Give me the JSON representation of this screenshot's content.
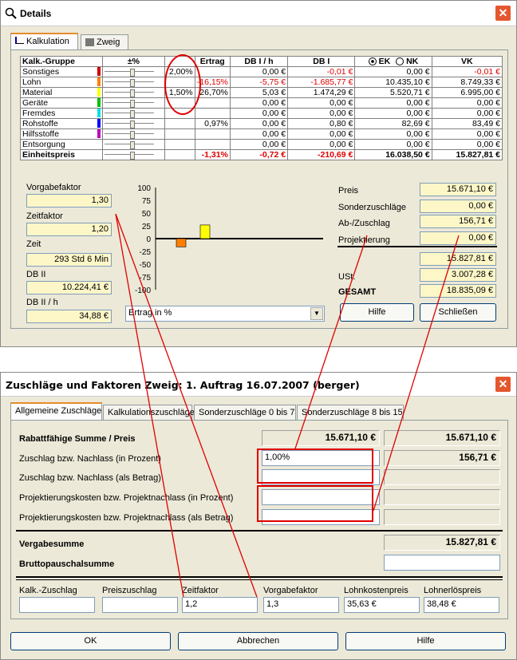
{
  "details": {
    "title": "Details",
    "close": "✕",
    "tabs": [
      "Kalkulation",
      "Zweig"
    ],
    "table": {
      "headers": [
        "Kalk.-Gruppe",
        "±%",
        "Ertrag",
        "DB I / h",
        "DB I",
        "EK",
        "NK",
        "VK"
      ],
      "rows": [
        {
          "name": "Sonstiges",
          "color": "#d00000",
          "pct": "2,00%",
          "ertrag": "",
          "dbih": "0,00 €",
          "dbi": "-0,01 €",
          "ek": "0,00 €",
          "vk": "-0,01 €",
          "red": {
            "dbi": true,
            "vk": true
          }
        },
        {
          "name": "Lohn",
          "color": "#ff7f00",
          "pct": "",
          "ertrag": "-16,15%",
          "dbih": "-5,75 €",
          "dbi": "-1.685,77 €",
          "ek": "10.435,10 €",
          "vk": "8.749,33 €",
          "red": {
            "ertrag": true,
            "dbih": true,
            "dbi": true
          }
        },
        {
          "name": "Material",
          "color": "#ffff00",
          "pct": "1,50%",
          "ertrag": "26,70%",
          "dbih": "5,03 €",
          "dbi": "1.474,29 €",
          "ek": "5.520,71 €",
          "vk": "6.995,00 €",
          "red": {}
        },
        {
          "name": "Geräte",
          "color": "#00c000",
          "pct": "",
          "ertrag": "",
          "dbih": "0,00 €",
          "dbi": "0,00 €",
          "ek": "0,00 €",
          "vk": "0,00 €",
          "red": {}
        },
        {
          "name": "Fremdes",
          "color": "#00e0e0",
          "pct": "",
          "ertrag": "",
          "dbih": "0,00 €",
          "dbi": "0,00 €",
          "ek": "0,00 €",
          "vk": "0,00 €",
          "red": {}
        },
        {
          "name": "Rohstoffe",
          "color": "#0000ff",
          "pct": "",
          "ertrag": "0,97%",
          "dbih": "0,00 €",
          "dbi": "0,80 €",
          "ek": "82,69 €",
          "vk": "83,49 €",
          "red": {}
        },
        {
          "name": "Hilfsstoffe",
          "color": "#c000c0",
          "pct": "",
          "ertrag": "",
          "dbih": "0,00 €",
          "dbi": "0,00 €",
          "ek": "0,00 €",
          "vk": "0,00 €",
          "red": {}
        },
        {
          "name": "Entsorgung",
          "color": "#ffffff",
          "pct": "",
          "ertrag": "",
          "dbih": "0,00 €",
          "dbi": "0,00 €",
          "ek": "0,00 €",
          "vk": "0,00 €",
          "red": {}
        },
        {
          "name": "Einheitspreis",
          "color": "#ffffff",
          "pct": "",
          "ertrag": "-1,31%",
          "dbih": "-0,72 €",
          "dbi": "-210,69 €",
          "ek": "16.038,50 €",
          "vk": "15.827,81 €",
          "red": {
            "ertrag": true,
            "dbih": true,
            "dbi": true
          },
          "bold": true
        }
      ]
    },
    "left": {
      "vorgabefaktor_label": "Vorgabefaktor",
      "vorgabefaktor": "1,30",
      "zeitfaktor_label": "Zeitfaktor",
      "zeitfaktor": "1,20",
      "zeit_label": "Zeit",
      "zeit": "293 Std 6 Min",
      "db2_label": "DB II",
      "db2": "10.224,41 €",
      "db2h_label": "DB II / h",
      "db2h": "34,88 €"
    },
    "chart_select": "Ertrag in %",
    "right": {
      "preis_label": "Preis",
      "preis": "15.671,10 €",
      "sonder_label": "Sonderzuschläge",
      "sonder": "0,00 €",
      "ab_label": "Ab-/Zuschlag",
      "ab": "156,71 €",
      "proj_label": "Projektierung",
      "proj": "0,00 €",
      "sum": "15.827,81 €",
      "ust_label": "USt.",
      "ust": "3.007,28 €",
      "gesamt_label": "GESAMT",
      "gesamt": "18.835,09 €"
    },
    "buttons": {
      "hilfe": "Hilfe",
      "schliessen": "Schließen"
    }
  },
  "chart_data": {
    "type": "bar",
    "categories": [
      "Lohn",
      "Material"
    ],
    "values": [
      -16.15,
      26.7
    ],
    "colors": [
      "#ff7f00",
      "#ffff00"
    ],
    "ylim": [
      -100,
      100
    ],
    "yticks": [
      "100",
      "75",
      "50",
      "25",
      "0",
      "-25",
      "-50",
      "-75",
      "-100"
    ]
  },
  "zuschlaege": {
    "title": "Zuschläge und Faktoren Zweig: 1. Auftrag 16.07.2007 (berger)",
    "close": "✕",
    "tabs": [
      "Allgemeine Zuschläge",
      "Kalkulationszuschläge",
      "Sonderzuschläge 0 bis 7",
      "Sonderzuschläge 8 bis 15"
    ],
    "rabatt_label": "Rabattfähige Summe / Preis",
    "rabatt1": "15.671,10 €",
    "rabatt2": "15.671,10 €",
    "zpct_label": "Zuschlag bzw. Nachlass (in Prozent)",
    "zpct": "1,00%",
    "zpct_val": "156,71 €",
    "zbetrag_label": "Zuschlag bzw. Nachlass (als Betrag)",
    "ppct_label": "Projektierungskosten bzw. Projektnachlass (in Prozent)",
    "pbetrag_label": "Projektierungskosten bzw. Projektnachlass (als Betrag)",
    "vergabe_label": "Vergabesumme",
    "vergabe": "15.827,81 €",
    "brutto_label": "Bruttopauschalsumme",
    "bottom": [
      {
        "label": "Kalk.-Zuschlag",
        "value": ""
      },
      {
        "label": "Preiszuschlag",
        "value": ""
      },
      {
        "label": "Zeitfaktor",
        "value": "1,2"
      },
      {
        "label": "Vorgabefaktor",
        "value": "1,3"
      },
      {
        "label": "Lohnkostenpreis",
        "value": "35,63 €"
      },
      {
        "label": "Lohnerlöspreis",
        "value": "38,48 €"
      }
    ],
    "buttons": {
      "ok": "OK",
      "abbrechen": "Abbrechen",
      "hilfe": "Hilfe"
    }
  }
}
